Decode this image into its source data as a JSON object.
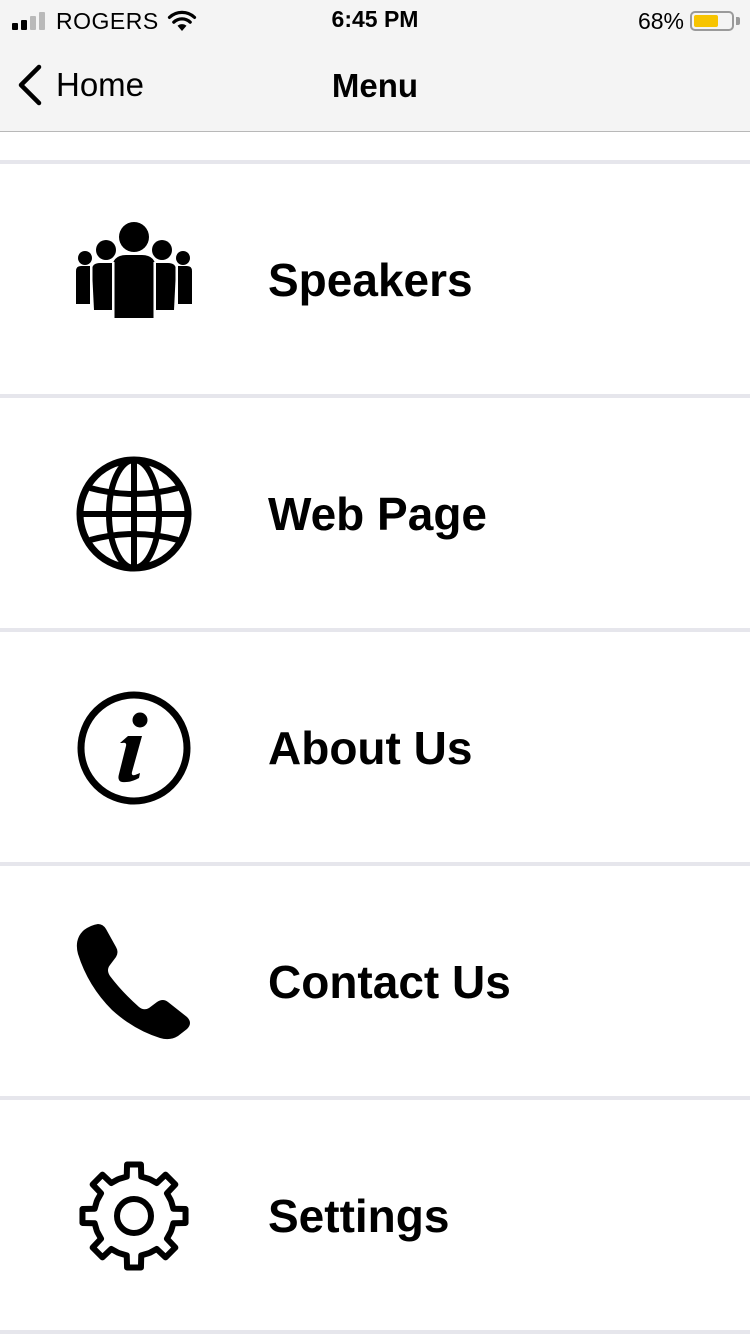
{
  "status_bar": {
    "carrier": "ROGERS",
    "time": "6:45 PM",
    "battery_percent_text": "68%",
    "battery_level": 0.68,
    "battery_color": "#f7c400",
    "signal_bars_filled": 2,
    "signal_bars_total": 4,
    "wifi_icon": "wifi-icon"
  },
  "nav": {
    "back_label": "Home",
    "back_icon": "chevron-left-icon",
    "title": "Menu"
  },
  "menu": {
    "items": [
      {
        "label": "Speakers",
        "icon": "people-group-icon"
      },
      {
        "label": "Web Page",
        "icon": "globe-icon"
      },
      {
        "label": "About Us",
        "icon": "info-icon"
      },
      {
        "label": "Contact Us",
        "icon": "phone-icon"
      },
      {
        "label": "Settings",
        "icon": "gear-icon"
      }
    ]
  },
  "colors": {
    "bar_background": "#f4f4f4",
    "separator": "#e6e6ec",
    "text": "#000000"
  }
}
